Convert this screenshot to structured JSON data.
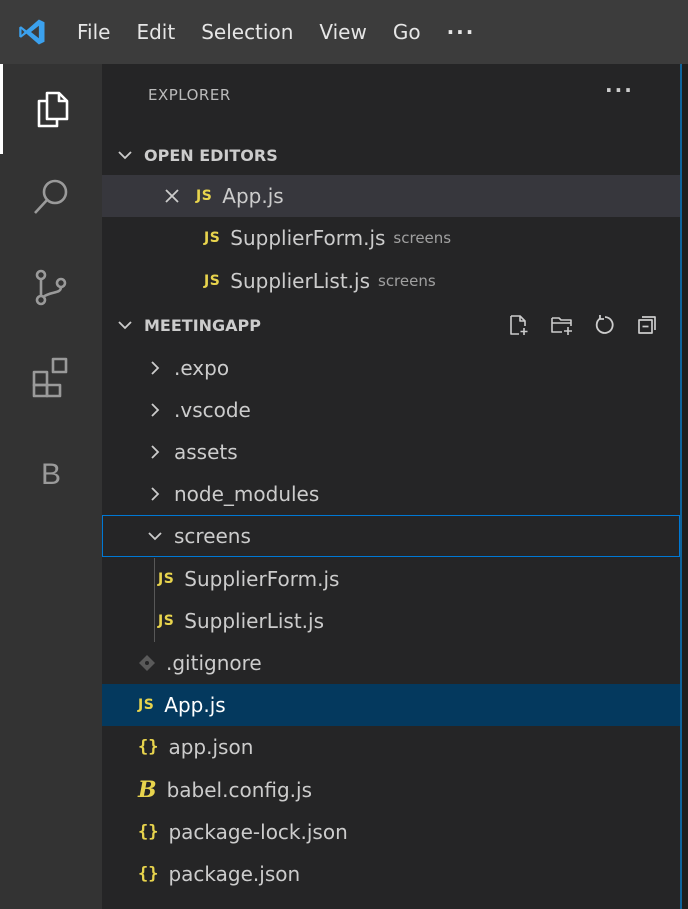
{
  "menu": {
    "items": [
      "File",
      "Edit",
      "Selection",
      "View",
      "Go"
    ],
    "more": "···"
  },
  "activity_bar": {
    "items": [
      {
        "name": "explorer",
        "icon": "files-icon",
        "active": true
      },
      {
        "name": "search",
        "icon": "search-icon"
      },
      {
        "name": "source-control",
        "icon": "source-control-icon"
      },
      {
        "name": "extensions",
        "icon": "extensions-icon"
      },
      {
        "name": "b-extension",
        "label": "B"
      }
    ]
  },
  "explorer": {
    "title": "EXPLORER",
    "more": "···",
    "open_editors": {
      "label": "OPEN EDITORS",
      "items": [
        {
          "badge": "JS",
          "name": "App.js",
          "desc": ""
        },
        {
          "badge": "JS",
          "name": "SupplierForm.js",
          "desc": "screens"
        },
        {
          "badge": "JS",
          "name": "SupplierList.js",
          "desc": "screens"
        }
      ]
    },
    "project": {
      "label": "MEETINGAPP",
      "folders": [
        ".expo",
        ".vscode",
        "assets",
        "node_modules",
        "screens"
      ],
      "screens_children": [
        {
          "badge": "JS",
          "name": "SupplierForm.js"
        },
        {
          "badge": "JS",
          "name": "SupplierList.js"
        }
      ],
      "files": [
        {
          "badge": "",
          "name": ".gitignore"
        },
        {
          "badge": "JS",
          "name": "App.js"
        },
        {
          "badge": "{}",
          "name": "app.json"
        },
        {
          "badge": "B",
          "name": "babel.config.js"
        },
        {
          "badge": "{}",
          "name": "package-lock.json"
        },
        {
          "badge": "{}",
          "name": "package.json"
        }
      ]
    }
  },
  "colors": {
    "accent": "#0078d4",
    "selection": "#04395e",
    "js_yellow": "#e8d44d",
    "logo_blue": "#3ba1ee"
  }
}
